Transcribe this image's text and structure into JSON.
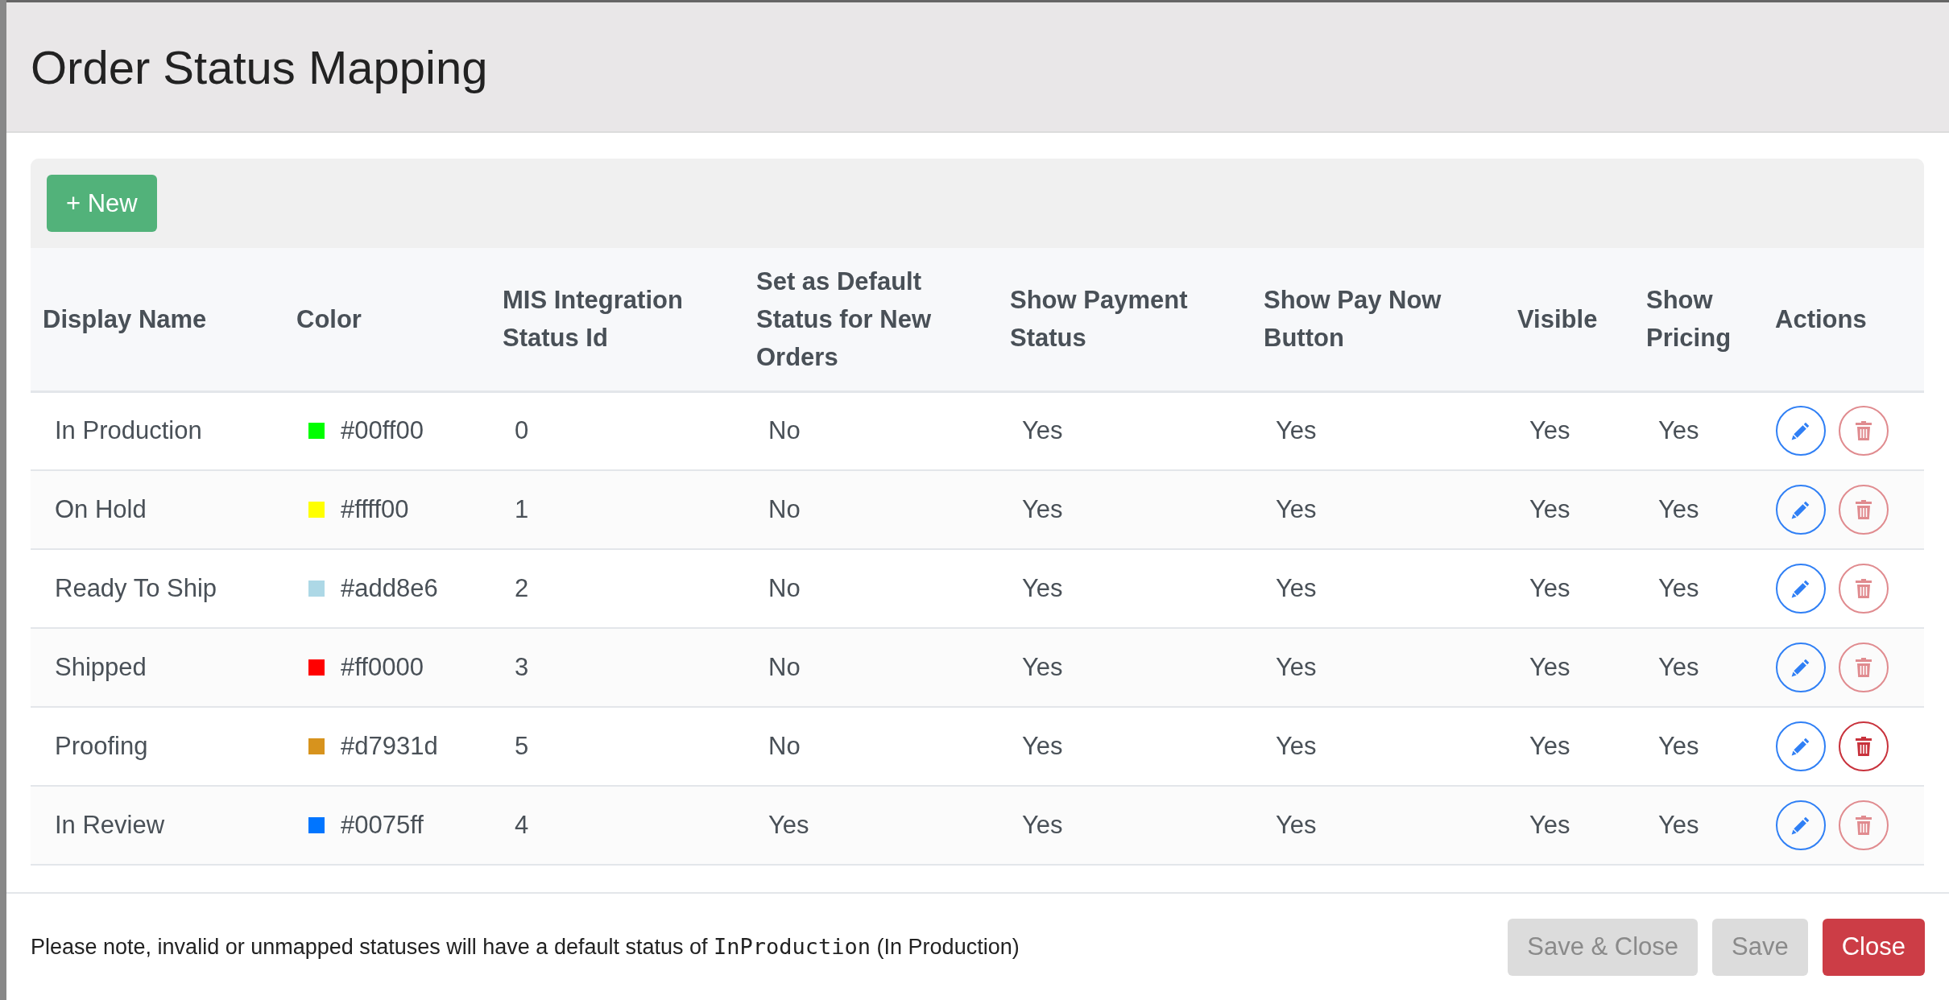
{
  "modal": {
    "title": "Order Status Mapping"
  },
  "toolbar": {
    "new_button": "+ New"
  },
  "table": {
    "columns": [
      "Display Name",
      "Color",
      "MIS Integration Status Id",
      "Set as Default Status for New Orders",
      "Show Payment Status",
      "Show Pay Now Button",
      "Visible",
      "Show Pricing",
      "Actions"
    ],
    "rows": [
      {
        "display_name": "In Production",
        "color": "#00ff00",
        "color_text": "#00ff00",
        "status_id": "0",
        "default": "No",
        "show_payment_status": "Yes",
        "show_pay_now": "Yes",
        "visible": "Yes",
        "show_pricing": "Yes",
        "delete_highlighted": false
      },
      {
        "display_name": "On Hold",
        "color": "#ffff00",
        "color_text": "#ffff00",
        "status_id": "1",
        "default": "No",
        "show_payment_status": "Yes",
        "show_pay_now": "Yes",
        "visible": "Yes",
        "show_pricing": "Yes",
        "delete_highlighted": false
      },
      {
        "display_name": "Ready To Ship",
        "color": "#add8e6",
        "color_text": "#add8e6",
        "status_id": "2",
        "default": "No",
        "show_payment_status": "Yes",
        "show_pay_now": "Yes",
        "visible": "Yes",
        "show_pricing": "Yes",
        "delete_highlighted": false
      },
      {
        "display_name": "Shipped",
        "color": "#ff0000",
        "color_text": "#ff0000",
        "status_id": "3",
        "default": "No",
        "show_payment_status": "Yes",
        "show_pay_now": "Yes",
        "visible": "Yes",
        "show_pricing": "Yes",
        "delete_highlighted": false
      },
      {
        "display_name": "Proofing",
        "color": "#d7931d",
        "color_text": "#d7931d",
        "status_id": "5",
        "default": "No",
        "show_payment_status": "Yes",
        "show_pay_now": "Yes",
        "visible": "Yes",
        "show_pricing": "Yes",
        "delete_highlighted": true
      },
      {
        "display_name": "In Review",
        "color": "#0075ff",
        "color_text": "#0075ff",
        "status_id": "4",
        "default": "Yes",
        "show_payment_status": "Yes",
        "show_pay_now": "Yes",
        "visible": "Yes",
        "show_pricing": "Yes",
        "delete_highlighted": false
      }
    ]
  },
  "footer": {
    "note": {
      "before": "Please note, invalid or unmapped statuses will have a default status of ",
      "code": "InProduction",
      "after": " (In Production)"
    },
    "buttons": [
      {
        "label": "Save & Close",
        "kind": "secondary",
        "disabled": true
      },
      {
        "label": "Save",
        "kind": "secondary",
        "disabled": true
      },
      {
        "label": "Close",
        "kind": "danger",
        "disabled": false
      }
    ]
  }
}
